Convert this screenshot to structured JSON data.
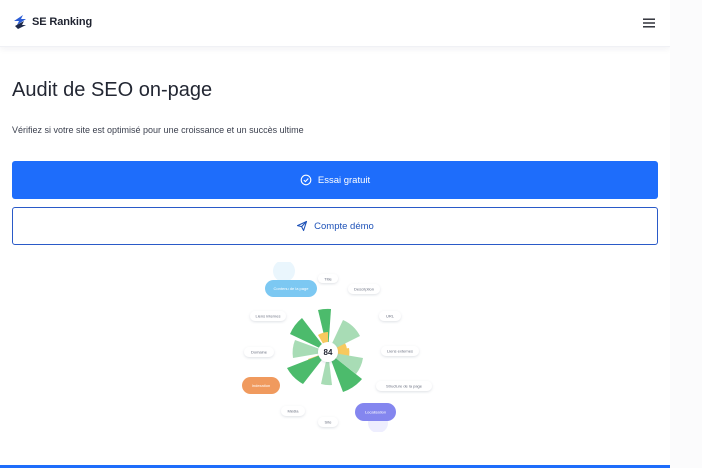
{
  "header": {
    "logo_text": "SE Ranking",
    "logo_icon": "se-ranking-logo-icon",
    "menu_icon": "hamburger-menu-icon"
  },
  "main": {
    "title": "Audit de SEO on-page",
    "subtitle": "Vérifiez si votre site est optimisé pour une croissance et un succès ultime",
    "primary_button": {
      "label": "Essai gratuit",
      "icon": "check-circle-icon"
    },
    "secondary_button": {
      "label": "Compte démo",
      "icon": "paper-plane-icon"
    }
  },
  "illustration": {
    "score": "84",
    "labels": {
      "title": "Title",
      "description": "Description",
      "url": "URL",
      "external_links": "Liens externes",
      "page_structure": "Structure de la page",
      "site": "Site",
      "media": "Média",
      "domain": "Domaine",
      "internal_links": "Liens internes"
    },
    "badges": {
      "page_content": "Contenu de la page",
      "indexing": "Indexation",
      "localization": "Localisation"
    }
  },
  "colors": {
    "accent": "#1e6dfb",
    "outline": "#2a5ac8",
    "green_dark": "#4cbb6c",
    "green_light": "#a8dcb5",
    "yellow": "#f7c95e",
    "badge_blue": "#7cc8f2",
    "badge_orange": "#f09a5e",
    "badge_purple": "#8486ef"
  }
}
